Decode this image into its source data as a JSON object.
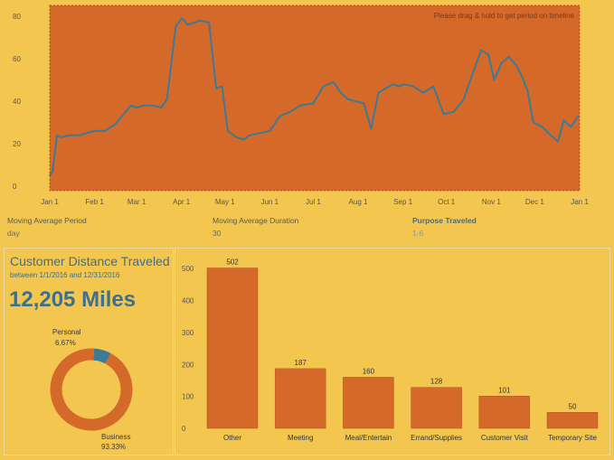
{
  "timeline": {
    "hint": "Please drag & hold to get period on timeline"
  },
  "params": {
    "moving_average_period_label": "Moving Average Period",
    "moving_average_period_value": "day",
    "moving_average_duration_label": "Moving Average Duration",
    "moving_average_duration_value": "30",
    "purpose_label": "Purpose Traveled",
    "purpose_value": "1-6"
  },
  "summary": {
    "title": "Customer Distance Traveled",
    "subtitle": "between 1/1/2016 and 12/31/2016",
    "total": "12,205 Miles"
  },
  "colors": {
    "background": "#f2c64f",
    "orange": "#d4692a",
    "blue": "#3d7a93"
  },
  "chart_data": [
    {
      "type": "line",
      "title": "",
      "xlabel": "",
      "ylabel": "",
      "ylim": [
        0,
        80
      ],
      "yticks": [
        "0",
        "20",
        "40",
        "60",
        "80"
      ],
      "xtick_labels": [
        "Jan 1",
        "Feb 1",
        "Mar 1",
        "Apr 1",
        "May 1",
        "Jun 1",
        "Jul 1",
        "Aug 1",
        "Sep 1",
        "Oct 1",
        "Nov 1",
        "Dec 1",
        "Jan 1"
      ],
      "x": [
        "2016-01-01",
        "2016-01-03",
        "2016-01-06",
        "2016-01-09",
        "2016-01-15",
        "2016-01-22",
        "2016-01-26",
        "2016-02-01",
        "2016-02-08",
        "2016-02-15",
        "2016-02-20",
        "2016-02-26",
        "2016-03-01",
        "2016-03-06",
        "2016-03-12",
        "2016-03-18",
        "2016-03-22",
        "2016-03-25",
        "2016-03-28",
        "2016-04-01",
        "2016-04-03",
        "2016-04-05",
        "2016-04-10",
        "2016-04-14",
        "2016-04-20",
        "2016-04-25",
        "2016-04-29",
        "2016-05-03",
        "2016-05-09",
        "2016-05-14",
        "2016-05-18",
        "2016-05-25",
        "2016-06-01",
        "2016-06-08",
        "2016-06-15",
        "2016-06-22",
        "2016-07-01",
        "2016-07-08",
        "2016-07-15",
        "2016-07-20",
        "2016-07-25",
        "2016-07-30",
        "2016-08-05",
        "2016-08-10",
        "2016-08-15",
        "2016-08-20",
        "2016-08-25",
        "2016-08-29",
        "2016-09-02",
        "2016-09-08",
        "2016-09-15",
        "2016-09-22",
        "2016-09-29",
        "2016-10-06",
        "2016-10-13",
        "2016-10-18",
        "2016-10-25",
        "2016-10-30",
        "2016-11-03",
        "2016-11-08",
        "2016-11-13",
        "2016-11-18",
        "2016-11-22",
        "2016-11-26",
        "2016-11-30",
        "2016-12-06",
        "2016-12-12",
        "2016-12-17",
        "2016-12-21",
        "2016-12-26",
        "2016-12-31"
      ],
      "values": [
        5,
        7,
        24,
        23,
        24,
        24,
        25,
        26,
        26,
        29,
        33,
        38,
        37,
        38,
        38,
        37,
        41,
        58,
        75,
        79,
        78,
        76,
        77,
        78,
        77,
        46,
        47,
        26,
        23,
        22,
        24,
        25,
        26,
        33,
        35,
        38,
        39,
        47,
        49,
        44,
        41,
        40,
        39,
        27,
        44,
        46,
        48,
        47,
        48,
        47,
        44,
        47,
        34,
        35,
        41,
        51,
        64,
        62,
        50,
        58,
        61,
        57,
        52,
        45,
        30,
        28,
        24,
        21,
        31,
        28,
        33
      ]
    },
    {
      "type": "pie",
      "labels": [
        "Business",
        "Personal"
      ],
      "values": [
        93.33,
        6.67
      ],
      "value_labels": [
        "93.33%",
        "6.67%"
      ]
    },
    {
      "type": "bar",
      "categories": [
        "Other",
        "Meeting",
        "Meal/Entertain",
        "Errand/Supplies",
        "Customer Visit",
        "Temporary Site"
      ],
      "values": [
        502,
        187,
        160,
        128,
        101,
        50
      ],
      "ylim": [
        0,
        560
      ],
      "yticks": [
        "0",
        "100",
        "200",
        "300",
        "400",
        "500"
      ]
    }
  ]
}
